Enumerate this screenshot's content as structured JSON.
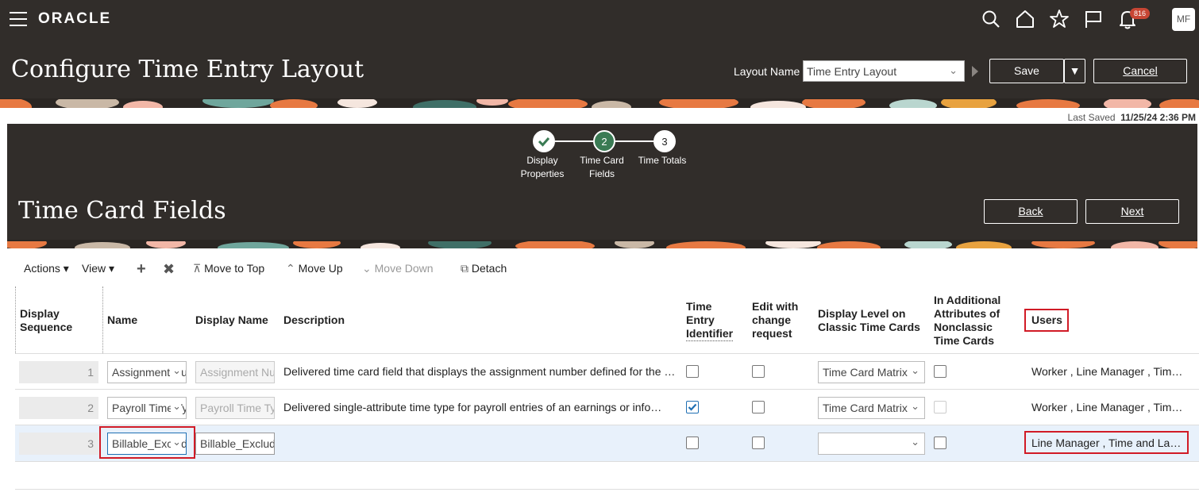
{
  "global_header": {
    "logo": "ORACLE",
    "notification_count": "816",
    "user_initials": "MF"
  },
  "page": {
    "title": "Configure Time Entry Layout",
    "layout_name_label": "Layout Name",
    "layout_name_value": "Time Entry Layout",
    "save_label": "Save",
    "cancel_label": "Cancel",
    "last_saved_label": "Last Saved",
    "last_saved_value": "11/25/24 2:36 PM"
  },
  "train": {
    "stops": [
      {
        "number": "",
        "label_line1": "Display",
        "label_line2": "Properties",
        "state": "done"
      },
      {
        "number": "2",
        "label_line1": "Time Card",
        "label_line2": "Fields",
        "state": "current"
      },
      {
        "number": "3",
        "label_line1": "Time Totals",
        "label_line2": "",
        "state": "next"
      }
    ]
  },
  "section": {
    "title": "Time Card Fields",
    "back_label": "Back",
    "next_label": "Next"
  },
  "toolbar": {
    "actions": "Actions",
    "view": "View",
    "move_to_top": "Move to Top",
    "move_up": "Move Up",
    "move_down": "Move Down",
    "detach": "Detach"
  },
  "columns": {
    "display_sequence_1": "Display",
    "display_sequence_2": "Sequence",
    "name": "Name",
    "display_name": "Display Name",
    "description": "Description",
    "tei_1": "Time",
    "tei_2": "Entry",
    "tei_3": "Identifier",
    "ewcr_1": "Edit with",
    "ewcr_2": "change",
    "ewcr_3": "request",
    "dl_1": "Display Level on",
    "dl_2": "Classic Time Cards",
    "aa_1": "In Additional",
    "aa_2": "Attributes of",
    "aa_3": "Nonclassic",
    "aa_4": "Time Cards",
    "users": "Users"
  },
  "rows": [
    {
      "seq": "1",
      "name": "Assignment Number",
      "display_name": "Assignment Number",
      "description": "Delivered time card field that displays the assignment number defined for the worker",
      "time_entry_identifier": false,
      "edit_with_change": false,
      "display_level": "Time Card Matrix",
      "additional_attr": false,
      "users": "Worker , Line Manager , Time and Labor Manager"
    },
    {
      "seq": "2",
      "name": "Payroll Time Type",
      "display_name": "Payroll Time Type",
      "description": "Delivered single-attribute time type for payroll entries of an earnings or information element",
      "time_entry_identifier": true,
      "edit_with_change": false,
      "display_level": "Time Card Matrix",
      "additional_attr": false,
      "users": "Worker , Line Manager , Time and Labor Manager"
    },
    {
      "seq": "3",
      "name": "Billable_Excluded",
      "display_name": "Billable_Excluded",
      "description": "",
      "time_entry_identifier": false,
      "edit_with_change": false,
      "display_level": "",
      "additional_attr": false,
      "users": "Line Manager , Time and Labor Manager"
    }
  ]
}
